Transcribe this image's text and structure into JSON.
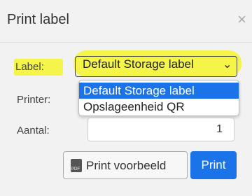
{
  "dialog": {
    "title": "Print label",
    "close_symbol": "×"
  },
  "form": {
    "label_caption": "Label:",
    "label_selected": "Default Storage label",
    "label_options": [
      "Default Storage label",
      "Opslageenheid QR"
    ],
    "printer_caption": "Printer:",
    "amount_caption": "Aantal:",
    "amount_value": "1"
  },
  "buttons": {
    "preview_label": "Print voorbeeld",
    "print_label": "Print"
  },
  "colors": {
    "accent": "#1a73e8",
    "highlight": "#f4f436"
  },
  "icons": {
    "close": "close-icon",
    "chevron": "chevron-down-icon",
    "pdf": "pdf-icon"
  }
}
